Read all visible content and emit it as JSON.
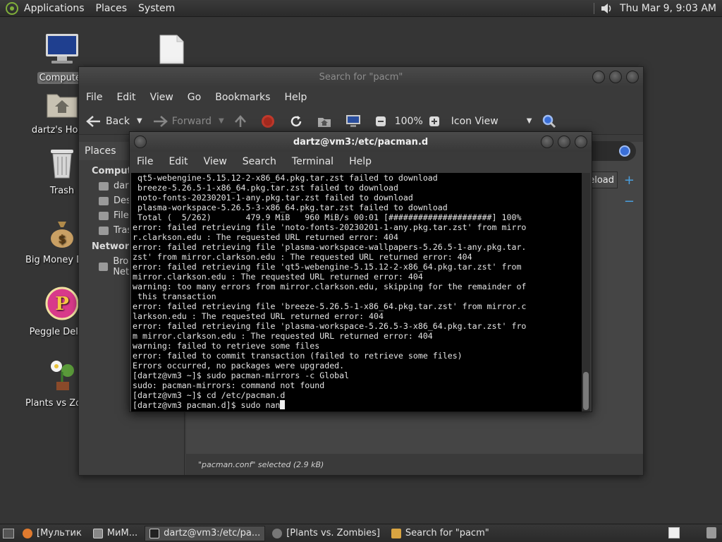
{
  "top_panel": {
    "menus": [
      "Applications",
      "Places",
      "System"
    ],
    "clock": "Thu Mar 9,  9:03 AM"
  },
  "desktop_icons": [
    {
      "label": "Computer",
      "icon": "computer-icon"
    },
    {
      "label": "",
      "icon": "document-icon"
    },
    {
      "label": "dartz's Home",
      "icon": "home-folder-icon"
    },
    {
      "label": "Trash",
      "icon": "trash-icon"
    },
    {
      "label": "Big Money Deluxe",
      "icon": "money-bag-icon"
    },
    {
      "label": "Peggle Deluxe",
      "icon": "peggle-icon"
    },
    {
      "label": "Plants vs Zombies",
      "icon": "flower-icon"
    }
  ],
  "file_manager": {
    "title": "Search for \"pacm\"",
    "menu": [
      "File",
      "Edit",
      "View",
      "Go",
      "Bookmarks",
      "Help"
    ],
    "toolbar": {
      "back": "Back",
      "forward": "Forward",
      "zoom": "100%",
      "view_mode": "Icon View"
    },
    "sidebar": {
      "header": "Places",
      "groups": [
        {
          "title": "Computer",
          "items": [
            "dartz",
            "Desktop",
            "File System",
            "Trash"
          ]
        },
        {
          "title": "Network",
          "items": [
            "Browse Network"
          ]
        }
      ]
    },
    "reload_label": "Reload",
    "status": "\"pacman.conf\" selected (2.9 kB)"
  },
  "terminal": {
    "title": "dartz@vm3:/etc/pacman.d",
    "menu": [
      "File",
      "Edit",
      "View",
      "Search",
      "Terminal",
      "Help"
    ],
    "lines": [
      " qt5-webengine-5.15.12-2-x86_64.pkg.tar.zst failed to download",
      " breeze-5.26.5-1-x86_64.pkg.tar.zst failed to download",
      " noto-fonts-20230201-1-any.pkg.tar.zst failed to download",
      " plasma-workspace-5.26.5-3-x86_64.pkg.tar.zst failed to download",
      " Total (  5/262)       479.9 MiB   960 MiB/s 00:01 [#####################] 100%",
      "error: failed retrieving file 'noto-fonts-20230201-1-any.pkg.tar.zst' from mirro",
      "r.clarkson.edu : The requested URL returned error: 404",
      "error: failed retrieving file 'plasma-workspace-wallpapers-5.26.5-1-any.pkg.tar.",
      "zst' from mirror.clarkson.edu : The requested URL returned error: 404",
      "error: failed retrieving file 'qt5-webengine-5.15.12-2-x86_64.pkg.tar.zst' from",
      "mirror.clarkson.edu : The requested URL returned error: 404",
      "warning: too many errors from mirror.clarkson.edu, skipping for the remainder of",
      " this transaction",
      "error: failed retrieving file 'breeze-5.26.5-1-x86_64.pkg.tar.zst' from mirror.c",
      "larkson.edu : The requested URL returned error: 404",
      "error: failed retrieving file 'plasma-workspace-5.26.5-3-x86_64.pkg.tar.zst' fro",
      "m mirror.clarkson.edu : The requested URL returned error: 404",
      "warning: failed to retrieve some files",
      "error: failed to commit transaction (failed to retrieve some files)",
      "Errors occurred, no packages were upgraded.",
      "[dartz@vm3 ~]$ sudo pacman-mirrors -c Global",
      "sudo: pacman-mirrors: command not found",
      "[dartz@vm3 ~]$ cd /etc/pacman.d"
    ],
    "prompt_line": "[dartz@vm3 pacman.d]$ sudo nan"
  },
  "taskbar": {
    "tasks": [
      {
        "label": "[Мультик",
        "icon": "firefox-icon",
        "active": false
      },
      {
        "label": "МиМ...",
        "icon": "app-grid-icon",
        "active": false
      },
      {
        "label": "dartz@vm3:/etc/pa...",
        "icon": "terminal-icon",
        "active": true
      },
      {
        "label": "[Plants vs. Zombies]",
        "icon": "gear-icon",
        "active": false
      },
      {
        "label": "Search for \"pacm\"",
        "icon": "folder-search-icon",
        "active": false
      }
    ]
  }
}
